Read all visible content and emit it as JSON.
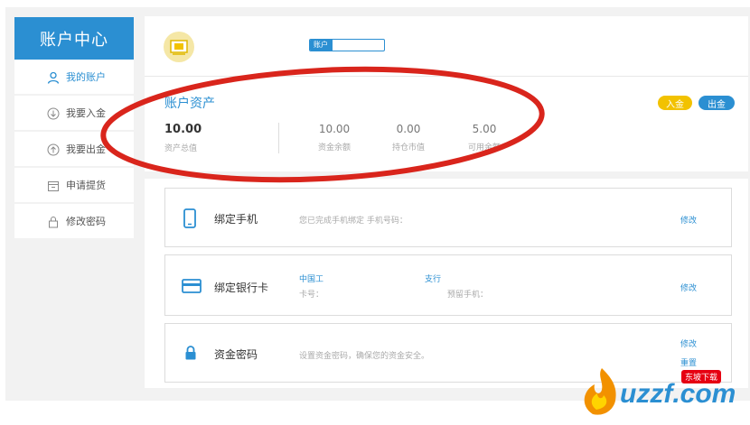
{
  "sidebar": {
    "title": "账户中心",
    "items": [
      {
        "label": "我的账户",
        "icon": "user-icon",
        "active": true
      },
      {
        "label": "我要入金",
        "icon": "download-circle-icon",
        "active": false
      },
      {
        "label": "我要出金",
        "icon": "upload-circle-icon",
        "active": false
      },
      {
        "label": "申请提货",
        "icon": "calendar-icon",
        "active": false
      },
      {
        "label": "修改密码",
        "icon": "lock-icon",
        "active": false
      }
    ]
  },
  "profile": {
    "progress_label": "账户",
    "progress_fraction": 0.3
  },
  "assets": {
    "title": "账户资产",
    "deposit_label": "入金",
    "withdraw_label": "出金",
    "total": {
      "value": "10.00",
      "label": "资产总值"
    },
    "stats": [
      {
        "value": "10.00",
        "label": "资金余额"
      },
      {
        "value": "0.00",
        "label": "持仓市值"
      },
      {
        "value": "5.00",
        "label": "可用余额"
      }
    ]
  },
  "cards": {
    "phone": {
      "title": "绑定手机",
      "desc": "您已完成手机绑定 手机号码：",
      "link": "修改",
      "icon": "phone-icon"
    },
    "bank": {
      "title": "绑定银行卡",
      "bank_prefix": "中国工",
      "bank_suffix": "支行",
      "card_no_label": "卡号：",
      "reserve_phone_label": "预留手机：",
      "link": "修改",
      "icon": "bank-card-icon"
    },
    "fund_pwd": {
      "title": "资金密码",
      "desc": "设置资金密码，确保您的资金安全。",
      "link_edit": "修改",
      "link_reset": "重置",
      "icon": "lock-icon"
    }
  },
  "watermark": {
    "brand": "uzzf.com",
    "badge": "东坡下载"
  },
  "colors": {
    "accent": "#2b8fd2",
    "deposit": "#f2c200",
    "annotation": "#d9251c"
  }
}
